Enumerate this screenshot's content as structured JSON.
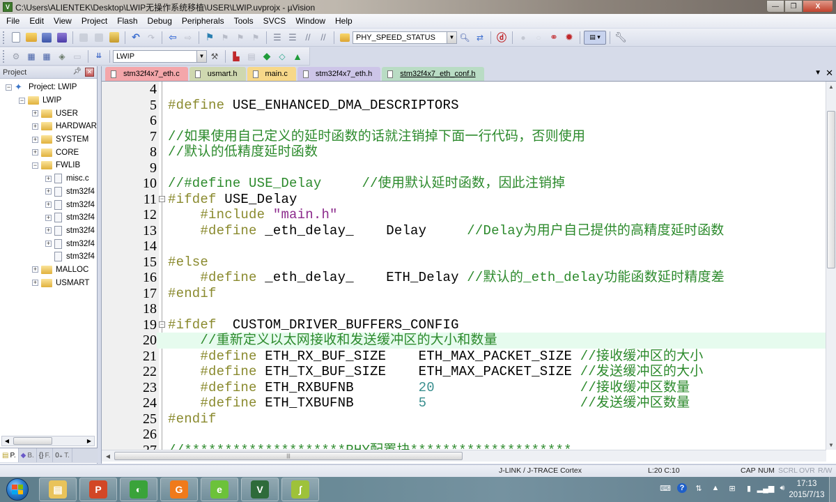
{
  "window": {
    "title": "C:\\Users\\ALIENTEK\\Desktop\\LWIP无操作系统移植\\USER\\LWIP.uvprojx - µVision",
    "app_icon": "uvision-icon",
    "controls": {
      "minimize": "—",
      "restore": "❐",
      "close": "X"
    }
  },
  "menu": [
    "File",
    "Edit",
    "View",
    "Project",
    "Flash",
    "Debug",
    "Peripherals",
    "Tools",
    "SVCS",
    "Window",
    "Help"
  ],
  "toolbar": {
    "find_combo_value": "PHY_SPEED_STATUS",
    "target_combo_value": "LWIP"
  },
  "project_pane": {
    "title": "Project",
    "tree": [
      {
        "label": "Project: LWIP",
        "type": "project",
        "level": 0,
        "expander": "−"
      },
      {
        "label": "LWIP",
        "type": "target",
        "level": 1,
        "expander": "−"
      },
      {
        "label": "USER",
        "type": "folder",
        "level": 2,
        "expander": "+"
      },
      {
        "label": "HARDWAR",
        "type": "folder",
        "level": 2,
        "expander": "+"
      },
      {
        "label": "SYSTEM",
        "type": "folder",
        "level": 2,
        "expander": "+"
      },
      {
        "label": "CORE",
        "type": "folder",
        "level": 2,
        "expander": "+"
      },
      {
        "label": "FWLIB",
        "type": "folder",
        "level": 2,
        "expander": "−"
      },
      {
        "label": "misc.c",
        "type": "file",
        "level": 3,
        "expander": "+"
      },
      {
        "label": "stm32f4",
        "type": "file",
        "level": 3,
        "expander": "+"
      },
      {
        "label": "stm32f4",
        "type": "file",
        "level": 3,
        "expander": "+"
      },
      {
        "label": "stm32f4",
        "type": "file",
        "level": 3,
        "expander": "+"
      },
      {
        "label": "stm32f4",
        "type": "file",
        "level": 3,
        "expander": "+"
      },
      {
        "label": "stm32f4",
        "type": "file",
        "level": 3,
        "expander": "+"
      },
      {
        "label": "stm32f4",
        "type": "file",
        "level": 3,
        "expander": ""
      },
      {
        "label": "MALLOC",
        "type": "folder",
        "level": 2,
        "expander": "+"
      },
      {
        "label": "USMART",
        "type": "folder",
        "level": 2,
        "expander": "+"
      }
    ],
    "bottom_tabs": [
      {
        "label": "P.",
        "icon": "project-icon",
        "active": true
      },
      {
        "label": "B.",
        "icon": "books-icon",
        "active": false
      },
      {
        "label": "F.",
        "icon": "functions-icon",
        "active": false
      },
      {
        "label": "T.",
        "icon": "templates-icon",
        "active": false
      }
    ]
  },
  "editor": {
    "tabs": [
      {
        "label": "stm32f4x7_eth.c",
        "color": "#f4a6aa",
        "active": false
      },
      {
        "label": "usmart.h",
        "color": "#cfd8b0",
        "active": false
      },
      {
        "label": "main.c",
        "color": "#f7d889",
        "active": false
      },
      {
        "label": "stm32f4x7_eth.h",
        "color": "#cdc5e8",
        "active": false
      },
      {
        "label": "stm32f4x7_eth_conf.h",
        "color": "#b9dcc4",
        "active": true
      }
    ],
    "lines": [
      {
        "n": "4",
        "tokens": []
      },
      {
        "n": "5",
        "tokens": [
          {
            "t": "#define",
            "c": "kw"
          },
          {
            "t": " USE_ENHANCED_DMA_DESCRIPTORS",
            "c": "id"
          }
        ]
      },
      {
        "n": "6",
        "tokens": []
      },
      {
        "n": "7",
        "tokens": [
          {
            "t": "//如果使用自己定义的延时函数的话就注销掉下面一行代码，否则使用",
            "c": "cm"
          }
        ]
      },
      {
        "n": "8",
        "tokens": [
          {
            "t": "//默认的低精度延时函数",
            "c": "cm"
          }
        ]
      },
      {
        "n": "9",
        "tokens": []
      },
      {
        "n": "10",
        "tokens": [
          {
            "t": "//#define USE_Delay     //使用默认延时函数，因此注销掉",
            "c": "cm"
          }
        ]
      },
      {
        "n": "11",
        "fold": true,
        "tokens": [
          {
            "t": "#ifdef",
            "c": "kw"
          },
          {
            "t": " USE_Delay",
            "c": "id"
          }
        ]
      },
      {
        "n": "12",
        "tokens": [
          {
            "t": "    #include",
            "c": "kw"
          },
          {
            "t": " \"main.h\"",
            "c": "str"
          }
        ]
      },
      {
        "n": "13",
        "tokens": [
          {
            "t": "    #define",
            "c": "kw"
          },
          {
            "t": " _eth_delay_    Delay     ",
            "c": "id"
          },
          {
            "t": "//Delay为用户自己提供的高精度延时函数",
            "c": "cm"
          }
        ]
      },
      {
        "n": "14",
        "tokens": []
      },
      {
        "n": "15",
        "tokens": [
          {
            "t": "#else",
            "c": "kw"
          }
        ]
      },
      {
        "n": "16",
        "tokens": [
          {
            "t": "    #define",
            "c": "kw"
          },
          {
            "t": " _eth_delay_    ETH_Delay ",
            "c": "id"
          },
          {
            "t": "//默认的_eth_delay功能函数延时精度差",
            "c": "cm"
          }
        ]
      },
      {
        "n": "17",
        "tokens": [
          {
            "t": "#endif",
            "c": "kw"
          }
        ]
      },
      {
        "n": "18",
        "tokens": []
      },
      {
        "n": "19",
        "fold": true,
        "tokens": [
          {
            "t": "#ifdef",
            "c": "kw"
          },
          {
            "t": "  CUSTOM_DRIVER_BUFFERS_CONFIG",
            "c": "id"
          }
        ]
      },
      {
        "n": "20",
        "highlight": true,
        "tokens": [
          {
            "t": "    //重新定义以太网接收和发送缓冲区的大小和数量",
            "c": "cm"
          }
        ]
      },
      {
        "n": "21",
        "tokens": [
          {
            "t": "    #define",
            "c": "kw"
          },
          {
            "t": " ETH_RX_BUF_SIZE    ETH_MAX_PACKET_SIZE ",
            "c": "id"
          },
          {
            "t": "//接收缓冲区的大小",
            "c": "cm"
          }
        ]
      },
      {
        "n": "22",
        "tokens": [
          {
            "t": "    #define",
            "c": "kw"
          },
          {
            "t": " ETH_TX_BUF_SIZE    ETH_MAX_PACKET_SIZE ",
            "c": "id"
          },
          {
            "t": "//发送缓冲区的大小",
            "c": "cm"
          }
        ]
      },
      {
        "n": "23",
        "tokens": [
          {
            "t": "    #define",
            "c": "kw"
          },
          {
            "t": " ETH_RXBUFNB        ",
            "c": "id"
          },
          {
            "t": "20",
            "c": "num"
          },
          {
            "t": "                  ",
            "c": "id"
          },
          {
            "t": "//接收缓冲区数量",
            "c": "cm"
          }
        ]
      },
      {
        "n": "24",
        "tokens": [
          {
            "t": "    #define",
            "c": "kw"
          },
          {
            "t": " ETH_TXBUFNB        ",
            "c": "id"
          },
          {
            "t": "5",
            "c": "num"
          },
          {
            "t": "                   ",
            "c": "id"
          },
          {
            "t": "//发送缓冲区数量",
            "c": "cm"
          }
        ]
      },
      {
        "n": "25",
        "tokens": [
          {
            "t": "#endif",
            "c": "kw"
          }
        ]
      },
      {
        "n": "26",
        "tokens": []
      },
      {
        "n": "27",
        "tokens": [
          {
            "t": "//********************PHY配置块********************",
            "c": "cm"
          }
        ]
      }
    ],
    "tabs_menu_icon": "▼",
    "tabs_close_icon": "✕"
  },
  "statusbar": {
    "debugger": "J-LINK / J-TRACE Cortex",
    "cursor": "L:20 C:10",
    "cap": "CAP",
    "num": "NUM",
    "scrl": "SCRL",
    "ovr": "OVR",
    "rw": "R/W"
  },
  "taskbar": {
    "apps": [
      {
        "name": "explorer",
        "glyph": "▤",
        "color": "#e9c35a"
      },
      {
        "name": "powerpoint",
        "glyph": "P",
        "color": "#d24726"
      },
      {
        "name": "green-circle-app",
        "glyph": "◐",
        "color": "#3aa33a"
      },
      {
        "name": "foxit-pdf",
        "glyph": "G",
        "color": "#f07a1a"
      },
      {
        "name": "browser",
        "glyph": "e",
        "color": "#6cc23a"
      },
      {
        "name": "keil-uvision",
        "glyph": "V",
        "color": "#2e6b3a"
      },
      {
        "name": "notepad-plus-plus",
        "glyph": "∫",
        "color": "#9ec23a"
      }
    ],
    "tray_icons": [
      "keyboard-icon",
      "help-icon",
      "network-switch-icon",
      "show-hidden-icon",
      "windows-flag-icon",
      "power-icon",
      "signal-icon",
      "volume-icon"
    ],
    "clock_time": "17:13",
    "clock_date": "2015/7/13"
  }
}
